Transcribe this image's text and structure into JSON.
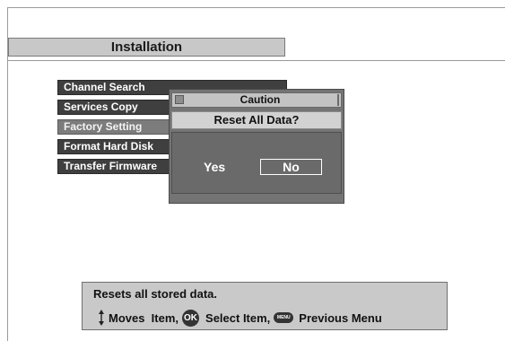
{
  "screen": {
    "title": "Installation"
  },
  "menu": {
    "items": [
      {
        "label": "Channel Search"
      },
      {
        "label": "Services Copy"
      },
      {
        "label": "Factory Setting"
      },
      {
        "label": "Format Hard Disk"
      },
      {
        "label": "Transfer Firmware"
      }
    ],
    "selected_index": 2
  },
  "dialog": {
    "title": "Caution",
    "question": "Reset All Data?",
    "yes_label": "Yes",
    "no_label": "No",
    "focused_button": "No"
  },
  "help": {
    "description": "Resets all stored data.",
    "hint_move": "Moves  Item,",
    "hint_select": "Select Item,",
    "hint_previous": "Previous Menu",
    "ok_icon_text": "OK",
    "menu_icon_text": "MENU"
  },
  "icons": {
    "updown": "up-down-arrow-icon",
    "ok": "ok-button-icon",
    "menu": "menu-button-icon"
  },
  "colors": {
    "menu_item_bg": "#3f3f3f",
    "menu_item_selected_bg": "#7c7c7c",
    "dialog_bg": "#747474",
    "panel_bg": "#c9c9c9"
  }
}
